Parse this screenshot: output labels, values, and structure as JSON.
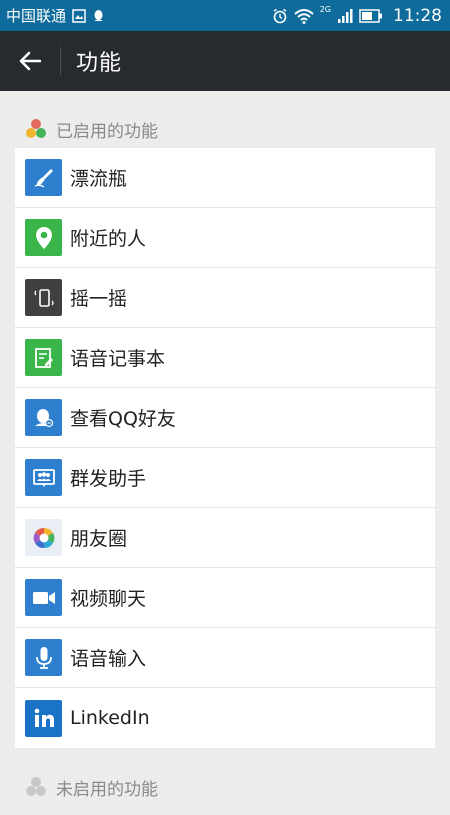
{
  "status_bar": {
    "carrier": "中国联通",
    "network": "2G",
    "time": "11:28"
  },
  "header": {
    "title": "功能"
  },
  "sections": {
    "enabled_title": "已启用的功能",
    "disabled_title": "未启用的功能"
  },
  "features": [
    {
      "label": "漂流瓶",
      "icon": "drift-bottle-icon",
      "color": "#2f7fcf"
    },
    {
      "label": "附近的人",
      "icon": "location-pin-icon",
      "color": "#3ab54a"
    },
    {
      "label": "摇一摇",
      "icon": "shake-phone-icon",
      "color": "#404040"
    },
    {
      "label": "语音记事本",
      "icon": "voice-notepad-icon",
      "color": "#3ab54a"
    },
    {
      "label": "查看QQ好友",
      "icon": "qq-friends-icon",
      "color": "#2f7fcf"
    },
    {
      "label": "群发助手",
      "icon": "mass-message-icon",
      "color": "#2f7fcf"
    },
    {
      "label": "朋友圈",
      "icon": "moments-icon",
      "color": "#e8eef3"
    },
    {
      "label": "视频聊天",
      "icon": "video-chat-icon",
      "color": "#2f7fcf"
    },
    {
      "label": "语音输入",
      "icon": "microphone-icon",
      "color": "#2f7fcf"
    },
    {
      "label": "LinkedIn",
      "icon": "linkedin-icon",
      "color": "#1a73c7"
    }
  ],
  "colors": {
    "status_bar": "#0e6b9c",
    "title_bar": "#272a2e",
    "background": "#ececec"
  }
}
